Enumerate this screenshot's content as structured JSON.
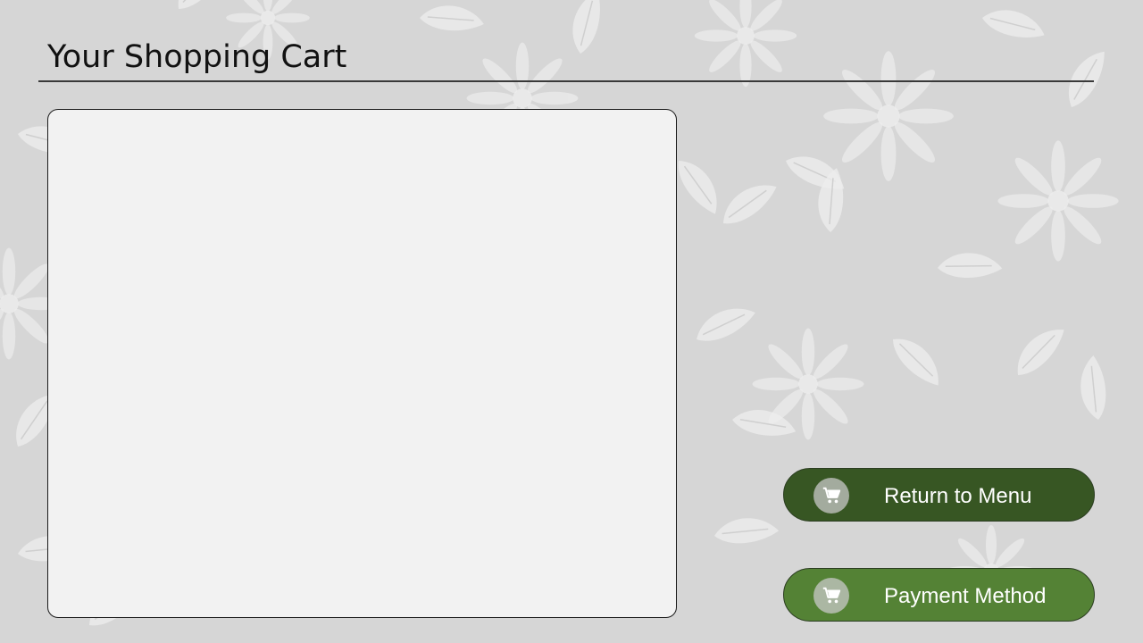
{
  "page": {
    "title": "Your Shopping Cart"
  },
  "buttons": {
    "return_label": "Return to Menu",
    "payment_label": "Payment Method"
  },
  "icons": {
    "return_icon": "shopping-cart-icon",
    "payment_icon": "shopping-cart-icon"
  },
  "colors": {
    "background": "#d9d9d9",
    "panel": "#f2f2f2",
    "return_button": "#375623",
    "payment_button": "#548235",
    "text": "#111111"
  }
}
